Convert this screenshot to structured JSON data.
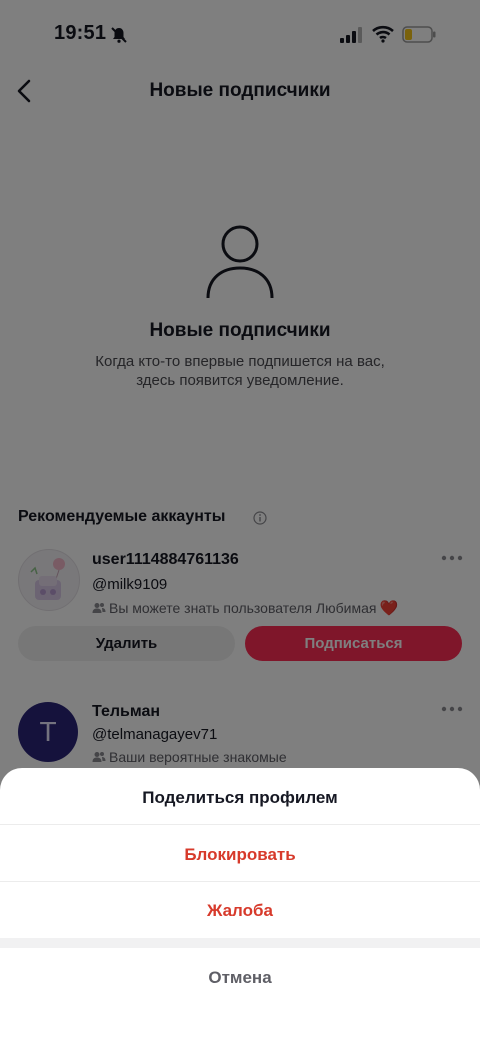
{
  "status_bar": {
    "time": "19:51"
  },
  "nav": {
    "title": "Новые подписчики"
  },
  "empty_state": {
    "title": "Новые подписчики",
    "description_line1": "Когда кто-то впервые подпишется на вас,",
    "description_line2": "здесь появится уведомление."
  },
  "suggestions": {
    "header": "Рекомендуемые аккаунты",
    "accounts": [
      {
        "name": "user1114884761136",
        "handle": "@milk9109",
        "reason": "Вы можете знать пользователя Любимая",
        "reason_emoji": "❤️",
        "remove_label": "Удалить",
        "follow_label": "Подписаться"
      },
      {
        "name": "Тельман",
        "handle": "@telmanagayev71",
        "reason": "Ваши вероятные знакомые",
        "avatar_letter": "T"
      }
    ]
  },
  "sheet": {
    "share_label": "Поделиться профилем",
    "block_label": "Блокировать",
    "report_label": "Жалоба",
    "cancel_label": "Отмена"
  },
  "colors": {
    "accent": "#fe2c55",
    "danger": "#d73a2b",
    "avatar2_bg": "#2b2578"
  }
}
